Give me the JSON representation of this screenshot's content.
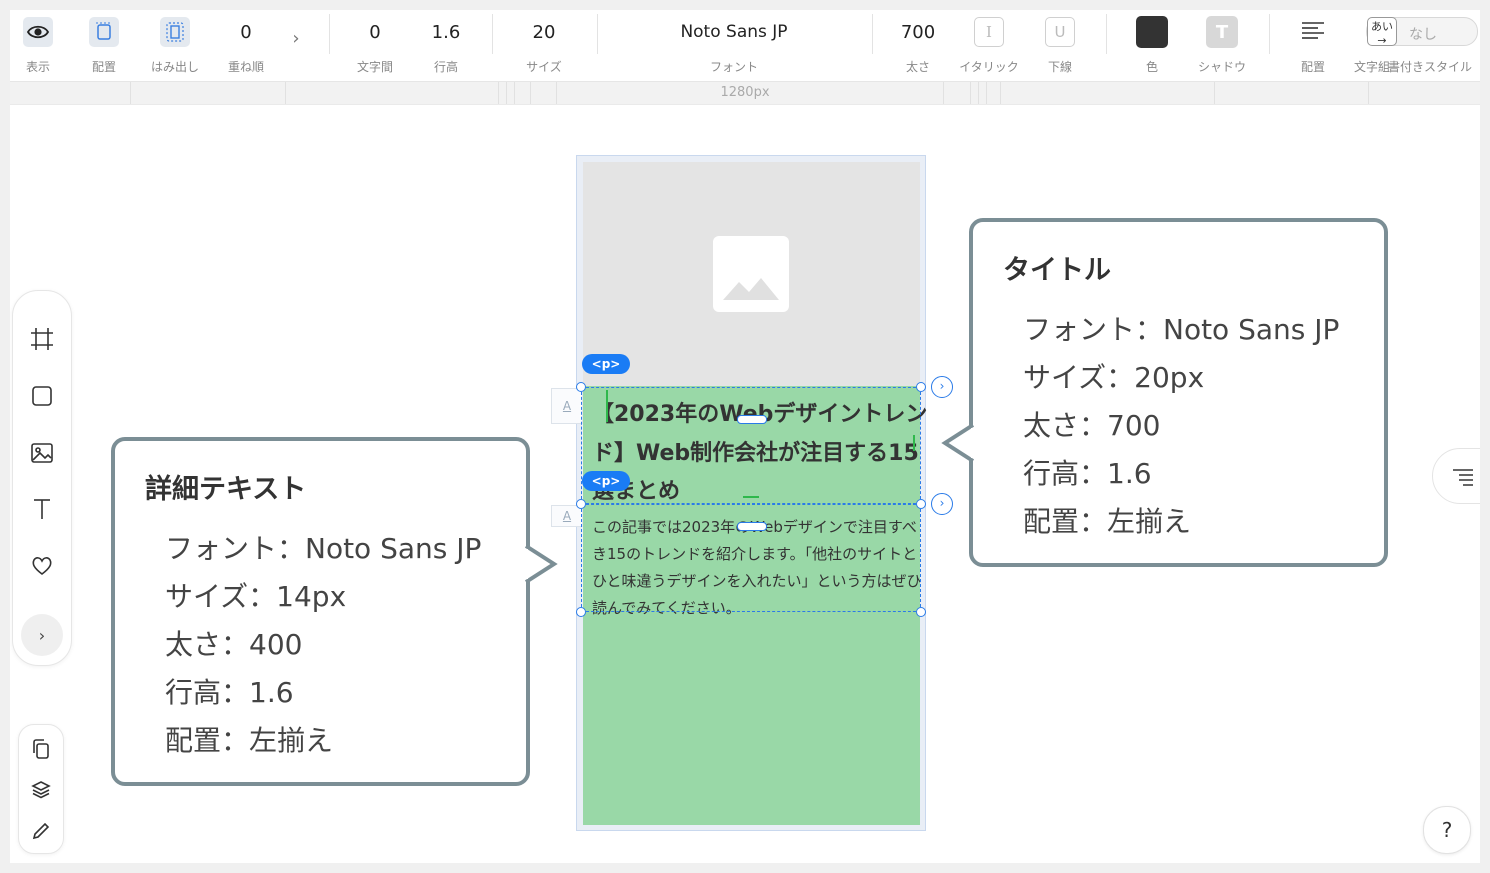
{
  "toolbar": {
    "view_label": "表示",
    "layout_label": "配置",
    "overflow_label": "はみ出し",
    "zorder_value": "0",
    "zorder_label": "重ね順",
    "letter_spacing_value": "0",
    "letter_spacing_label": "文字間",
    "line_height_value": "1.6",
    "line_height_label": "行高",
    "size_value": "20",
    "size_label": "サイズ",
    "font_value": "Noto Sans JP",
    "font_label": "フォント",
    "weight_value": "700",
    "weight_label": "太さ",
    "italic_glyph": "I",
    "italic_label": "イタリック",
    "underline_glyph": "U",
    "underline_label": "下線",
    "color_label": "色",
    "color_value": "#333333",
    "shadow_glyph": "T",
    "shadow_label": "シャドウ",
    "align_label": "配置",
    "writing_label": "文字組",
    "style_label": "書付きスタイル",
    "style_icon_text": "あい",
    "style_value": "なし"
  },
  "ruler": {
    "width_label": "1280px"
  },
  "canvas": {
    "title_tag": "<p>",
    "body_tag": "<p>",
    "title_text": "【2023年のWebデザイントレンド】Web制作会社が注目する15選まとめ",
    "body_text": "この記事では2023年のWebデザインで注目すべき15のトレンドを紹介します。「他社のサイトとひと味違うデザインを入れたい」という方はぜひ読んでみてください。",
    "card_color": "#99d8a7",
    "text_icon": "A"
  },
  "callout_title": {
    "heading": "タイトル",
    "font": "フォント：Noto Sans JP",
    "size": "サイズ：20px",
    "weight": "太さ：700",
    "line_height": "行高：1.6",
    "align": "配置：左揃え"
  },
  "callout_body": {
    "heading": "詳細テキスト",
    "font": "フォント：Noto Sans JP",
    "size": "サイズ：14px",
    "weight": "太さ：400",
    "line_height": "行高：1.6",
    "align": "配置：左揃え"
  },
  "help": {
    "label": "?"
  },
  "colors": {
    "accent": "#1a7cf5",
    "callout_border": "#7b8e95"
  }
}
